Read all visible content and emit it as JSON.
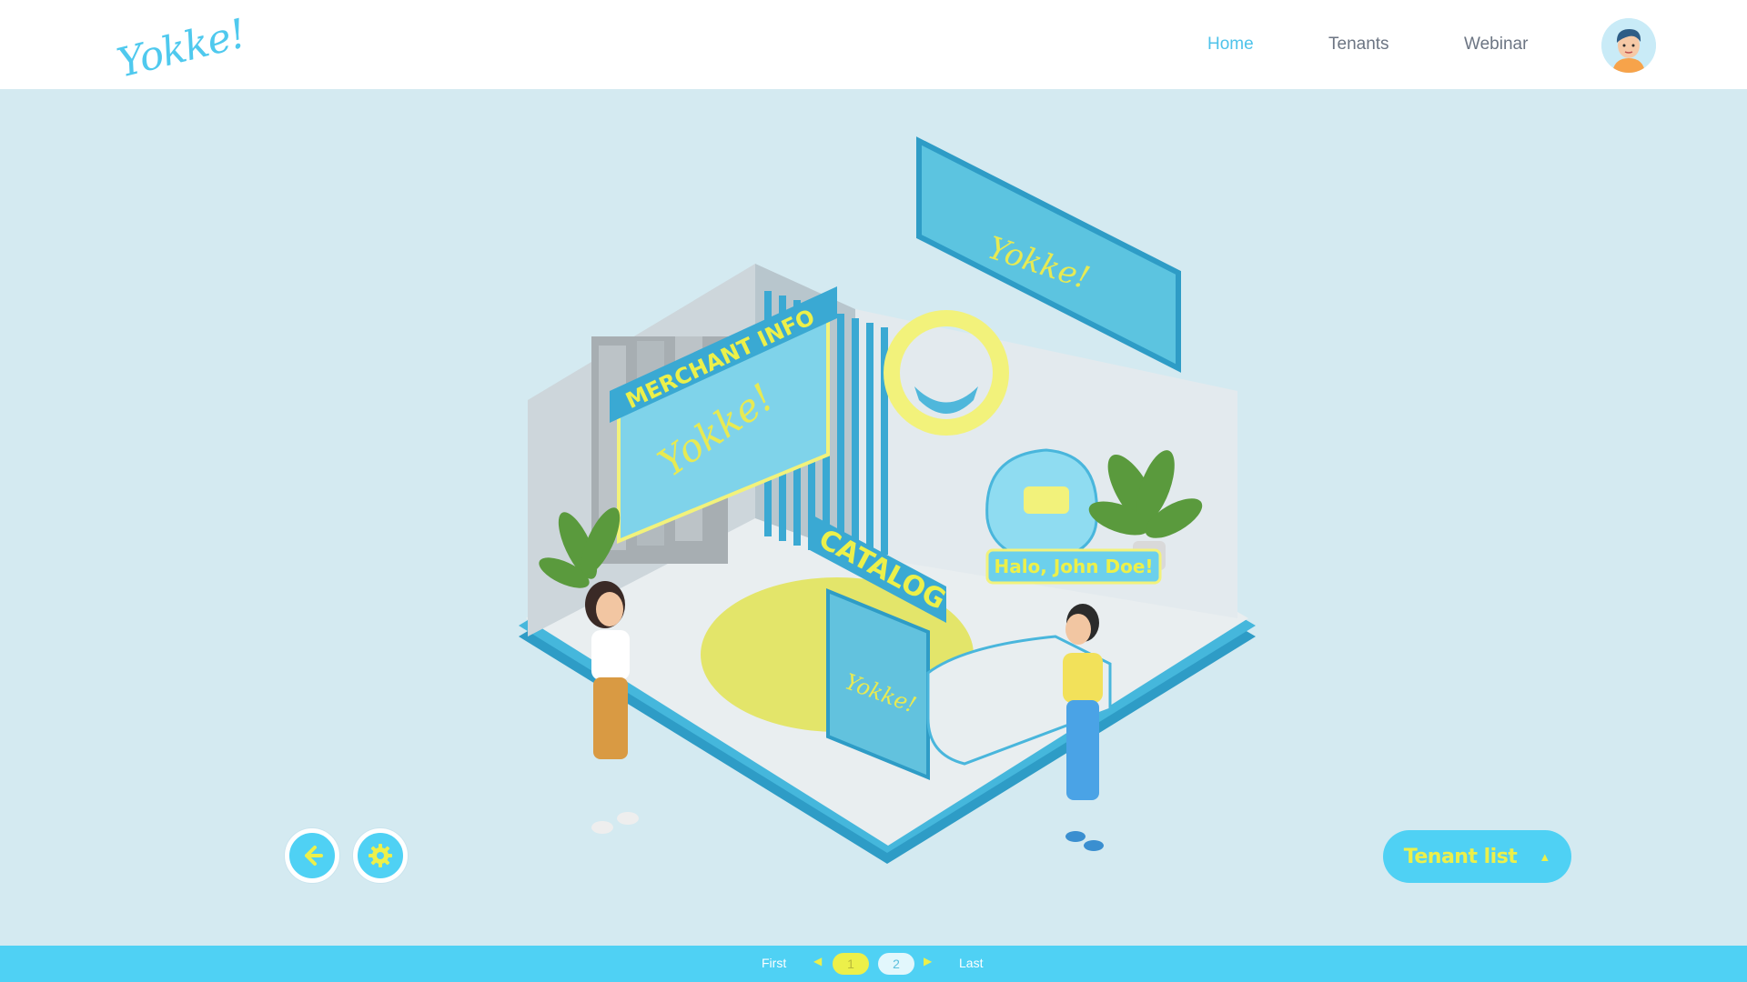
{
  "header": {
    "logo_text": "Yokke!",
    "nav": [
      {
        "label": "Home",
        "active": true
      },
      {
        "label": "Tenants",
        "active": false
      },
      {
        "label": "Webinar",
        "active": false
      }
    ],
    "avatar_icon": "user-avatar-icon"
  },
  "booth": {
    "brand_text": "Yokke!",
    "merchant_sign": "MERCHANT INFO",
    "catalog_sign": "CATALOG",
    "greeting": "Halo, John Doe!"
  },
  "controls": {
    "back_icon": "arrow-left-icon",
    "settings_icon": "gear-icon",
    "tenant_list_label": "Tenant list",
    "tenant_list_icon": "caret-up-icon"
  },
  "pagination": {
    "first_label": "First",
    "last_label": "Last",
    "pages": [
      "1",
      "2"
    ],
    "current_page": "1"
  },
  "colors": {
    "accent": "#4fd1f4",
    "highlight": "#ecf04a",
    "background": "#d4eaf1",
    "nav_active": "#4fc3ea",
    "nav_text": "#6c7583"
  }
}
